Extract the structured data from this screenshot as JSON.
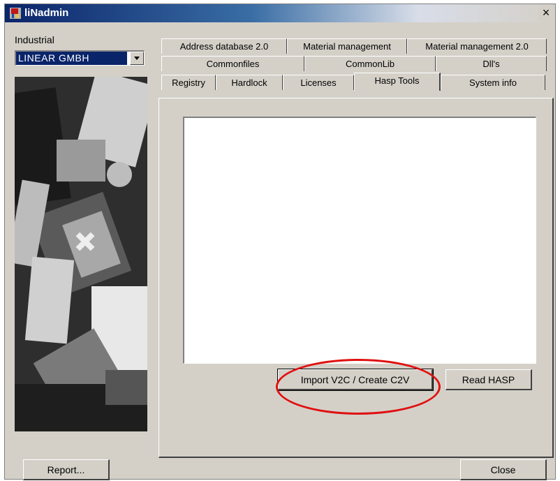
{
  "window": {
    "title": "liNadmin",
    "close_glyph": "×",
    "icon": "app-icon"
  },
  "left": {
    "industrial_label": "Industrial",
    "company_select_value": "LINEAR GMBH"
  },
  "tabs": {
    "row1": [
      "Address database 2.0",
      "Material management",
      "Material management 2.0"
    ],
    "row2": [
      "Commonfiles",
      "CommonLib",
      "Dll's"
    ],
    "row3": [
      "Registry",
      "Hardlock",
      "Licenses",
      "Hasp Tools",
      "System info"
    ],
    "active": "Hasp Tools"
  },
  "hasp_tools": {
    "import_button": "Import V2C / Create C2V",
    "read_button": "Read HASP"
  },
  "footer": {
    "report_button": "Report...",
    "close_button": "Close"
  },
  "colors": {
    "title_bar": "#0a246a",
    "selection": "#0a246a",
    "highlight_ellipse": "#e01010",
    "face": "#d4d0c8"
  }
}
